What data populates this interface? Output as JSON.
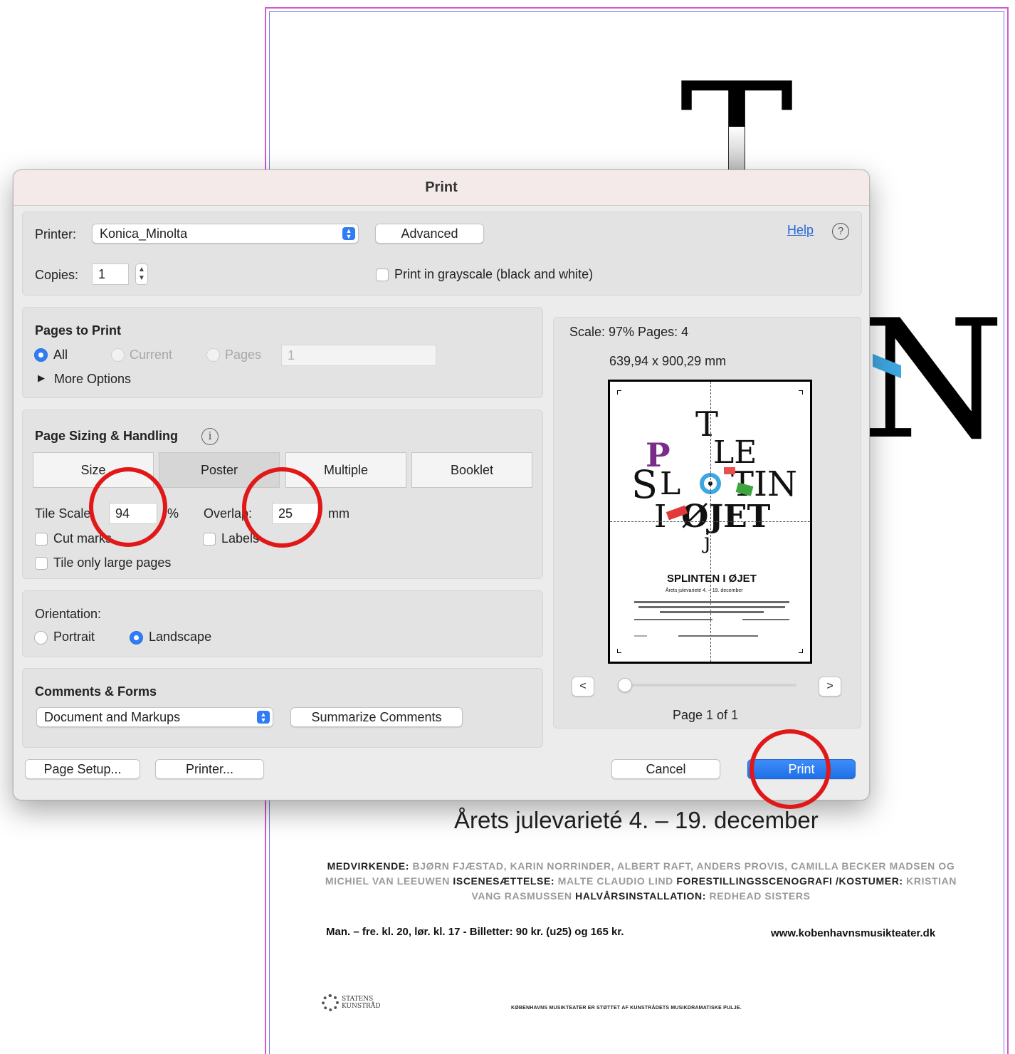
{
  "background_document": {
    "subtitle": "Årets julevarieté 4. – 19. december",
    "credits": [
      {
        "role": "MEDVIRKENDE: ",
        "names": "BJØRN FJÆSTAD, KARIN NORRINDER, ALBERT RAFT, ANDERS PROVIS, CAMILLA BECKER MADSEN OG MICHIEL VAN LEEUWEN "
      },
      {
        "role": "ISCENESÆTTELSE: ",
        "names": "MALTE CLAUDIO LIND "
      },
      {
        "role": "FORESTILLINGSSCENOGRAFI /KOSTUMER: ",
        "names": "KRISTIAN VANG RASMUSSEN "
      },
      {
        "role": "HALVÅRSINSTALLATION: ",
        "names": "REDHEAD SISTERS"
      }
    ],
    "showtimes": "Man. – fre. kl. 20, lør. kl. 17 - Billetter: 90 kr. (u25) og 165 kr.",
    "website": "www.kobenhavnsmusikteater.dk",
    "logo_text_line1": "STATENS",
    "logo_text_line2": "KUNSTRÅD",
    "footnote": "KØBENHAVNS MUSIKTEATER ER STØTTET AF KUNSTRÅDETS MUSIKDRAMATISKE PULJE."
  },
  "dialog": {
    "title": "Print",
    "printer_label": "Printer:",
    "printer_value": "Konica_Minolta",
    "advanced_button": "Advanced",
    "help_link": "Help",
    "help_icon": "?",
    "copies_label": "Copies:",
    "copies_value": "1",
    "grayscale_label": "Print in grayscale (black and white)",
    "grayscale_checked": false,
    "pages_to_print": {
      "heading": "Pages to Print",
      "all": "All",
      "current": "Current",
      "pages": "Pages",
      "pages_value": "1",
      "selected": "All",
      "more_options": "More Options"
    },
    "page_sizing": {
      "heading": "Page Sizing & Handling",
      "info_icon": "i",
      "tabs": [
        "Size",
        "Poster",
        "Multiple",
        "Booklet"
      ],
      "selected_tab": "Poster",
      "tile_scale_label": "Tile Scale:",
      "tile_scale_value": "94",
      "tile_scale_unit": "%",
      "overlap_label": "Overlap:",
      "overlap_value": "25",
      "overlap_unit": "mm",
      "cut_marks": "Cut marks",
      "labels": "Labels",
      "tile_only_large": "Tile only large pages"
    },
    "orientation": {
      "heading": "Orientation:",
      "portrait": "Portrait",
      "landscape": "Landscape",
      "selected": "Landscape"
    },
    "comments_forms": {
      "heading": "Comments & Forms",
      "value": "Document and Markups",
      "summarize_button": "Summarize Comments"
    },
    "preview": {
      "scale_text": "Scale:  97% Pages: 4",
      "dimensions": "639,94 x 900,29 mm",
      "prev": "<",
      "next": ">",
      "page_indicator": "Page 1 of 1",
      "thumb_title": "SPLINTEN I ØJET",
      "thumb_subtitle": "Årets julevarieté 4. – 19. december"
    },
    "buttons": {
      "page_setup": "Page Setup...",
      "printer": "Printer...",
      "cancel": "Cancel",
      "print": "Print"
    }
  },
  "colors": {
    "accent_blue": "#2f7cf6",
    "annotation_red": "#e01818",
    "page_border_magenta": "#d05ad0"
  }
}
